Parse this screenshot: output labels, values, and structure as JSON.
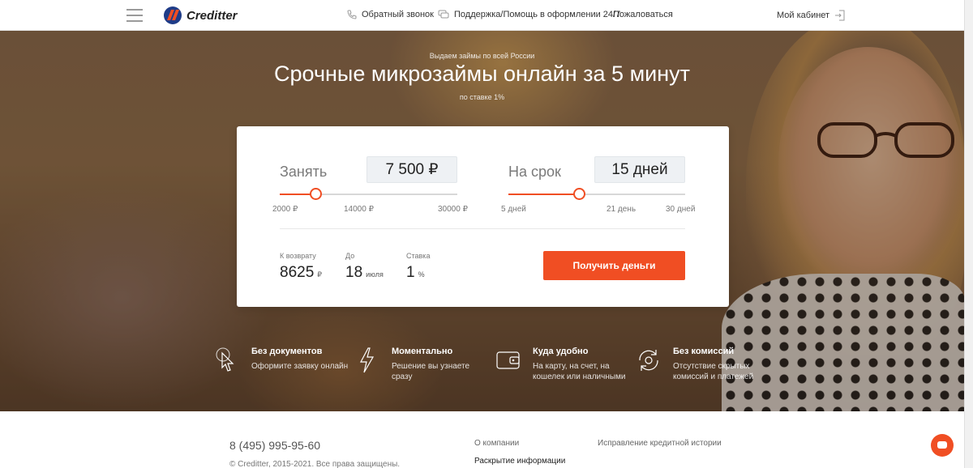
{
  "header": {
    "brand": "Creditter",
    "nav": [
      "Обратный звонок",
      "Поддержка/Помощь в оформлении 24/7",
      "Пожаловаться"
    ],
    "cabinet": "Мой кабинет",
    "accent": "#f04e23"
  },
  "hero": {
    "subtitle": "Выдаем займы по всей России",
    "title": "Срочные микрозаймы онлайн за 5 минут",
    "rate_note": "по ставке 1%"
  },
  "calculator": {
    "amount": {
      "label": "Занять",
      "value": "7 500 ₽",
      "level": 0.2,
      "ticks": [
        "2000 ₽",
        "14000 ₽",
        "30000 ₽"
      ]
    },
    "term": {
      "label": "На срок",
      "value": "15 дней",
      "level": 0.4,
      "ticks": [
        "5 дней",
        "21 день",
        "30 дней"
      ]
    },
    "summary": {
      "return_label": "К возврату",
      "return_value": "8625",
      "return_unit": "₽",
      "until_label": "До",
      "until_value": "18",
      "until_unit": "июля",
      "rate_label": "Ставка",
      "rate_value": "1",
      "rate_unit": "%"
    },
    "cta": "Получить деньги"
  },
  "features": [
    {
      "icon": "cursor-click-icon",
      "title": "Без документов",
      "desc": "Оформите заявку онлайн"
    },
    {
      "icon": "lightning-icon",
      "title": "Моментально",
      "desc": "Решение вы узнаете сразу"
    },
    {
      "icon": "wallet-icon",
      "title": "Куда удобно",
      "desc": "На карту, на счет, на кошелек или наличными"
    },
    {
      "icon": "refresh-icon",
      "title": "Без комиссий",
      "desc": "Отсутствие скрытых комиссий и платежей"
    }
  ],
  "footer": {
    "phone": "8 (495) 995-95-60",
    "copyright": "© Creditter, 2015-2021. Все права защищены.",
    "links": [
      "О компании",
      "Раскрытие информации",
      "Исправление кредитной истории"
    ]
  }
}
